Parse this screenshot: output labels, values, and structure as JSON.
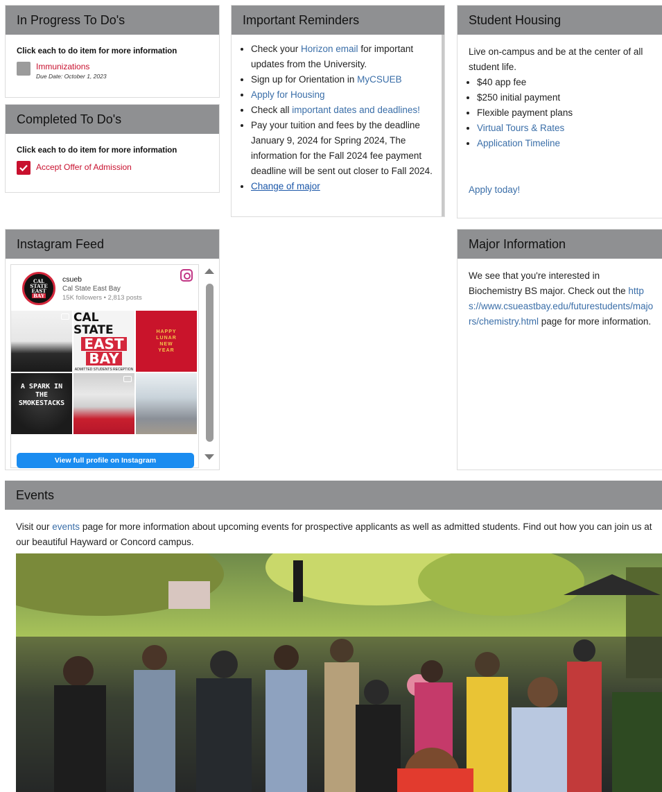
{
  "in_progress": {
    "title": "In Progress To Do's",
    "instruction": "Click each to do item for more information",
    "items": [
      {
        "label": "Immunizations",
        "due": "Due Date: October 1, 2023"
      }
    ]
  },
  "completed": {
    "title": "Completed To Do's",
    "instruction": "Click each to do item for more information",
    "items": [
      {
        "label": "Accept Offer of Admission"
      }
    ]
  },
  "reminders": {
    "title": "Important Reminders",
    "items": [
      {
        "pre": "Check your ",
        "link": "Horizon email",
        "post": " for important updates from the University."
      },
      {
        "pre": "Sign up for Orientation in ",
        "link": "MyCSUEB",
        "post": ""
      },
      {
        "pre": "",
        "link": "Apply for Housing",
        "post": ""
      },
      {
        "pre": "Check all ",
        "link": "important dates and deadlines!",
        "post": ""
      },
      {
        "pre": "Pay your tuition and fees by the deadline January 9, 2024 for Spring 2024, The information for the Fall 2024 fee payment deadline will be sent out closer to Fall 2024.",
        "link": "",
        "post": ""
      },
      {
        "pre": "",
        "link": "Change of major",
        "post": ""
      }
    ]
  },
  "housing": {
    "title": "Student Housing",
    "intro": "Live on-campus and be at the center of all student life.",
    "bullets": [
      "$40 app fee",
      "$250 initial payment",
      "Flexible payment plans"
    ],
    "links": [
      "Virtual Tours & Rates",
      "Application Timeline"
    ],
    "apply": "Apply today!"
  },
  "instagram": {
    "title": "Instagram Feed",
    "handle": "csueb",
    "name": "Cal State East Bay",
    "stats": "15K followers • 2,813 posts",
    "logo_lines": [
      "CAL",
      "STATE",
      "EAST",
      "BAY"
    ],
    "tile2": {
      "line1": "CAL STATE",
      "line2": "EAST",
      "line3": "BAY",
      "sub": "ADMITTED STUDENTS RECEPTION"
    },
    "tile3": {
      "text": "HAPPY LUNAR NEW YEAR"
    },
    "tile4": {
      "text": "A SPARK IN THE SMOKESTACKS"
    },
    "button": "View full profile on Instagram"
  },
  "major": {
    "title": "Major Information",
    "pre": "We see that you're interested in Biochemistry BS major. Check out the ",
    "link": "https://www.csueastbay.edu/futurestudents/majors/chemistry.html",
    "post": " page for more information."
  },
  "events": {
    "title": "Events",
    "pre": "Visit our ",
    "link": "events",
    "post": " page for more information about upcoming events for prospective applicants as well as admitted students. Find out how you can join us at our beautiful Hayward or Concord campus."
  },
  "colors": {
    "header_bg": "#8f9092",
    "link": "#3a6ea8",
    "todo_red": "#c8102e",
    "insta_blue": "#1a8cf0"
  }
}
